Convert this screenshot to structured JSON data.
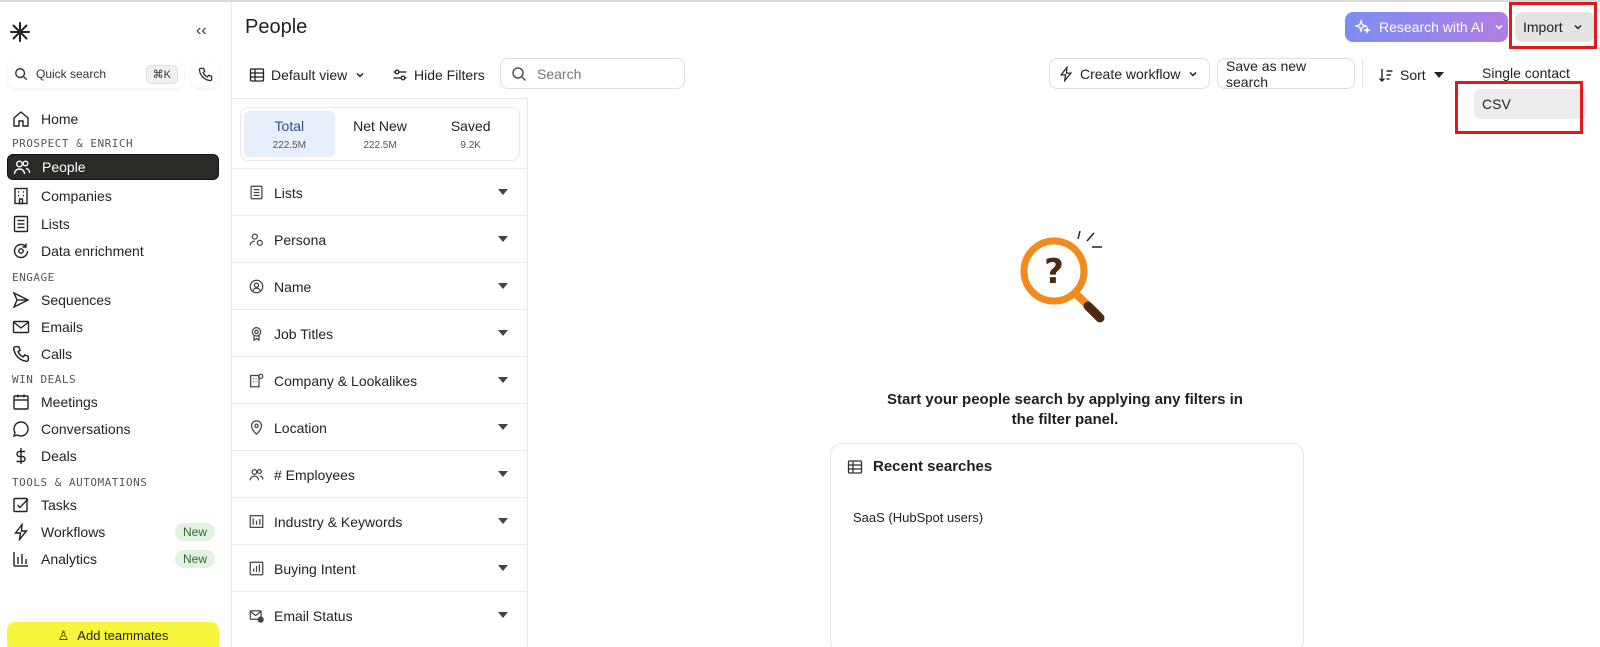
{
  "app": {
    "page_title": "People"
  },
  "sidebar": {
    "quick_search_label": "Quick search",
    "quick_search_shortcut": "⌘K",
    "home": "Home",
    "sections": {
      "prospect": "PROSPECT & ENRICH",
      "engage": "ENGAGE",
      "win": "WIN DEALS",
      "tools": "TOOLS & AUTOMATIONS"
    },
    "items": {
      "people": "People",
      "companies": "Companies",
      "lists": "Lists",
      "data_enrichment": "Data enrichment",
      "sequences": "Sequences",
      "emails": "Emails",
      "calls": "Calls",
      "meetings": "Meetings",
      "conversations": "Conversations",
      "deals": "Deals",
      "tasks": "Tasks",
      "workflows": "Workflows",
      "analytics": "Analytics"
    },
    "new_badge": "New",
    "add_teammates": "Add teammates"
  },
  "header": {
    "research_label": "Research with AI",
    "import_label": "Import"
  },
  "toolbar": {
    "default_view": "Default view",
    "hide_filters": "Hide Filters",
    "search_placeholder": "Search",
    "create_workflow": "Create workflow",
    "save_search": "Save as new search",
    "sort": "Sort"
  },
  "import_menu": {
    "single_contact": "Single contact",
    "csv": "CSV"
  },
  "filter_tabs": [
    {
      "label": "Total",
      "count": "222.5M"
    },
    {
      "label": "Net New",
      "count": "222.5M"
    },
    {
      "label": "Saved",
      "count": "9.2K"
    }
  ],
  "filters": [
    "Lists",
    "Persona",
    "Name",
    "Job Titles",
    "Company & Lookalikes",
    "Location",
    "# Employees",
    "Industry & Keywords",
    "Buying Intent",
    "Email Status"
  ],
  "empty_state": {
    "message": "Start your people search by applying any filters in the filter panel."
  },
  "recent": {
    "title": "Recent searches",
    "items": [
      "SaaS (HubSpot users)"
    ]
  },
  "colors": {
    "accent_orange": "#f28a1e",
    "active_nav": "#2a2a26",
    "highlight_red": "#e0191c",
    "add_teammates_bg": "#f5f53b"
  }
}
